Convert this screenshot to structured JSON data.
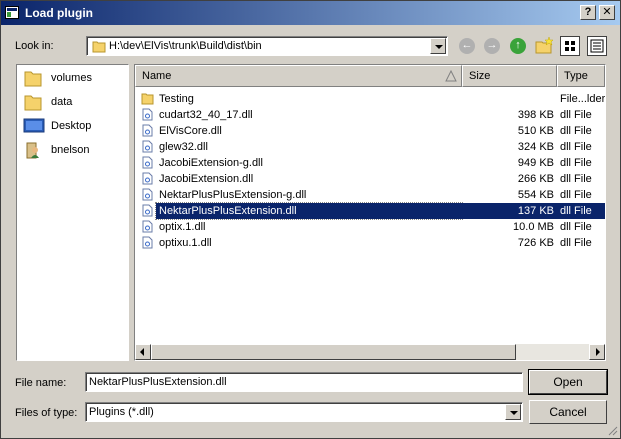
{
  "window": {
    "title": "Load plugin"
  },
  "lookin": {
    "label": "Look in:",
    "path": "H:\\dev\\ElVis\\trunk\\Build\\dist\\bin"
  },
  "places": [
    {
      "label": "volumes",
      "icon": "folder-icon"
    },
    {
      "label": "data",
      "icon": "folder-icon"
    },
    {
      "label": "Desktop",
      "icon": "desktop-icon"
    },
    {
      "label": "bnelson",
      "icon": "user-folder-icon"
    }
  ],
  "columns": {
    "name": "Name",
    "size": "Size",
    "type": "Type"
  },
  "files": [
    {
      "name": "Testing",
      "size": "",
      "type": "File...lder",
      "kind": "folder"
    },
    {
      "name": "cudart32_40_17.dll",
      "size": "398 KB",
      "type": "dll File",
      "kind": "dll"
    },
    {
      "name": "ElVisCore.dll",
      "size": "510 KB",
      "type": "dll File",
      "kind": "dll"
    },
    {
      "name": "glew32.dll",
      "size": "324 KB",
      "type": "dll File",
      "kind": "dll"
    },
    {
      "name": "JacobiExtension-g.dll",
      "size": "949 KB",
      "type": "dll File",
      "kind": "dll"
    },
    {
      "name": "JacobiExtension.dll",
      "size": "266 KB",
      "type": "dll File",
      "kind": "dll"
    },
    {
      "name": "NektarPlusPlusExtension-g.dll",
      "size": "554 KB",
      "type": "dll File",
      "kind": "dll"
    },
    {
      "name": "NektarPlusPlusExtension.dll",
      "size": "137 KB",
      "type": "dll File",
      "kind": "dll",
      "selected": true
    },
    {
      "name": "optix.1.dll",
      "size": "10.0 MB",
      "type": "dll File",
      "kind": "dll"
    },
    {
      "name": "optixu.1.dll",
      "size": "726 KB",
      "type": "dll File",
      "kind": "dll"
    }
  ],
  "filename": {
    "label": "File name:",
    "value": "NektarPlusPlusExtension.dll"
  },
  "filetype": {
    "label": "Files of type:",
    "value": "Plugins (*.dll)"
  },
  "buttons": {
    "open": "Open",
    "cancel": "Cancel"
  },
  "colors": {
    "selection": "#0a246a",
    "titlebar": "#0a246a",
    "face": "#d4d0c8"
  }
}
